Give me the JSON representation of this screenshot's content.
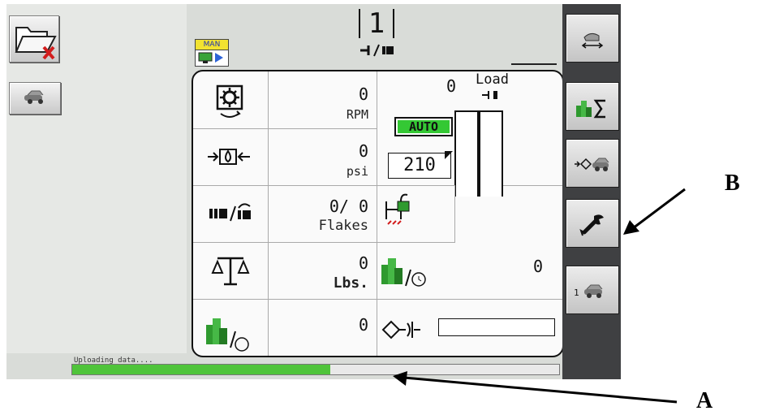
{
  "header": {
    "mode_badge": "MAN",
    "selected_number": "1"
  },
  "readouts": {
    "rpm": {
      "value": "0",
      "unit": "RPM"
    },
    "pressure": {
      "value": "0",
      "unit": "psi"
    },
    "flakes": {
      "value": "0/ 0",
      "unit": "Flakes"
    },
    "weight": {
      "value": "0",
      "unit": "Lbs."
    },
    "bale_rate": {
      "value": "0"
    },
    "bale_count": {
      "value": "0"
    },
    "load": {
      "title": "Load",
      "value": "0"
    },
    "auto_badge": "AUTO",
    "setpoint": "210"
  },
  "status": {
    "text": "Uploading data....",
    "progress_fraction": 0.53
  },
  "callouts": {
    "a": "A",
    "b": "B"
  },
  "colors": {
    "progress": "#4fc43a",
    "auto_badge_bg": "#34c834",
    "mode_badge_bg": "#f2e230",
    "panel_border": "#111111",
    "right_bar": "#3f4042"
  },
  "icons": {
    "left_top": "folder-delete-icon",
    "left_second": "machine-icon",
    "right_buttons": [
      "hand-calibrate-icon",
      "bale-total-icon",
      "machine-arrow-icon",
      "wrench-icon",
      "machine-1-icon"
    ]
  }
}
